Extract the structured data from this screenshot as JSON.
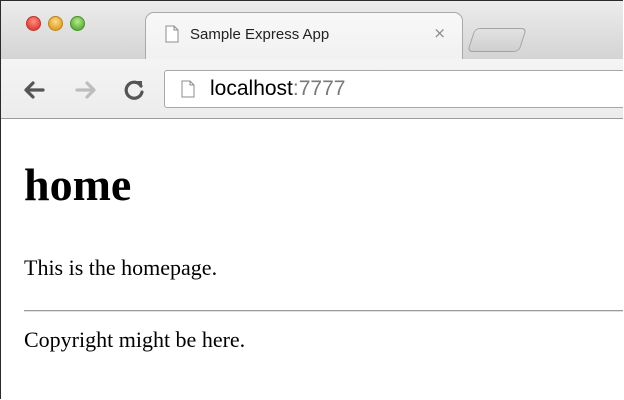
{
  "browser": {
    "tab": {
      "title": "Sample Express App",
      "close_glyph": "×",
      "favicon": "page-icon"
    },
    "new_tab": "new-tab-icon",
    "toolbar": {
      "back_icon": "back-arrow-icon",
      "forward_icon": "forward-arrow-icon",
      "reload_icon": "reload-icon"
    },
    "omnibox": {
      "page_icon": "page-icon",
      "host": "localhost",
      "port": ":7777"
    }
  },
  "page": {
    "heading": "home",
    "paragraph": "This is the homepage.",
    "footer": "Copyright might be here."
  },
  "colors": {
    "traffic_close": "#e0443a",
    "traffic_minimize": "#e1a32a",
    "traffic_zoom": "#5db53a",
    "url_port": "#7a7a7a"
  }
}
